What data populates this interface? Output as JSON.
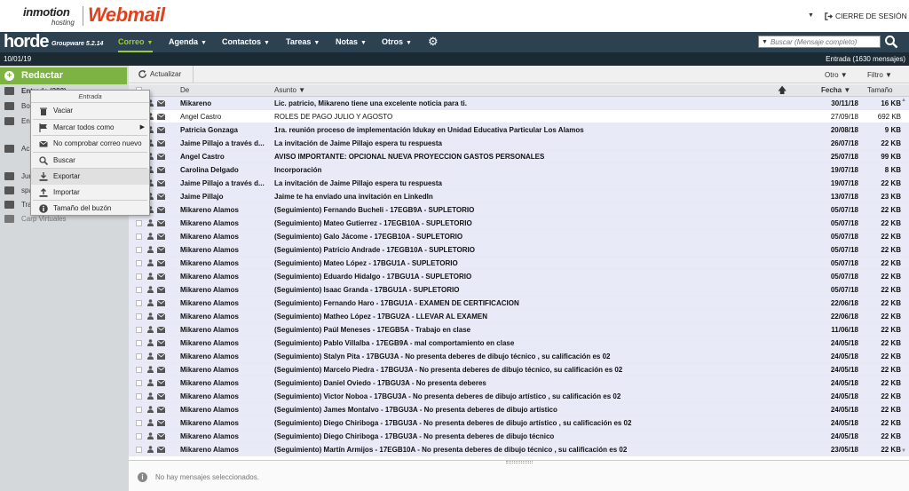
{
  "brand": {
    "inmotion": "inmotion",
    "hosting": "hosting",
    "webmail": "Webmail"
  },
  "header": {
    "logout_label": "CIERRE DE SESIÓN"
  },
  "topnav": {
    "logo": "horde",
    "version": "Groupware 5.2.14",
    "items": [
      {
        "label": "Correo",
        "active": true
      },
      {
        "label": "Agenda",
        "active": false
      },
      {
        "label": "Contactos",
        "active": false
      },
      {
        "label": "Tareas",
        "active": false
      },
      {
        "label": "Notas",
        "active": false
      },
      {
        "label": "Otros",
        "active": false
      }
    ],
    "search_placeholder": "Buscar (Mensaje completo)"
  },
  "statusbar": {
    "date": "10/01/19",
    "mailbox_info": "Entrada (1630 mensajes)"
  },
  "sidebar": {
    "compose_label": "Redactar",
    "folders": [
      {
        "label": "Entrada (282)",
        "icon": "inbox-icon"
      },
      {
        "label": "Bo",
        "icon": "drafts-icon"
      },
      {
        "label": "En",
        "icon": "sent-icon"
      },
      {
        "label": "Ac",
        "icon": "folder-icon"
      },
      {
        "label": "Jur",
        "icon": "folder-icon"
      },
      {
        "label": "spa",
        "icon": "folder-icon"
      },
      {
        "label": "Tra",
        "icon": "trash-icon"
      },
      {
        "label": "Carp Virtuales",
        "icon": "virtual-folder-icon"
      }
    ]
  },
  "context_menu": {
    "title": "Entrada",
    "items": [
      {
        "label": "Vaciar",
        "icon": "trash-icon"
      },
      {
        "label": "Marcar todos como",
        "icon": "flag-icon",
        "submenu": true
      },
      {
        "label": "No comprobar correo nuevo",
        "icon": "envelope-icon"
      },
      {
        "label": "Buscar",
        "icon": "search-icon"
      },
      {
        "label": "Exportar",
        "icon": "download-icon",
        "highlighted": true
      },
      {
        "label": "Importar",
        "icon": "upload-icon"
      },
      {
        "label": "Tamaño del buzón",
        "icon": "info-icon"
      }
    ]
  },
  "toolbar": {
    "refresh_label": "Actualizar",
    "other_label": "Otro",
    "filter_label": "Filtro"
  },
  "columns": {
    "from": "De",
    "subject": "Asunto",
    "date": "Fecha",
    "size": "Tamaño"
  },
  "messages": [
    {
      "from": "Mikareno",
      "subject": "Lic. patricio, Mikareno tiene una excelente noticia para ti.",
      "date": "30/11/18",
      "size": "16 KB",
      "unseen": true
    },
    {
      "from": "Angel Castro",
      "subject": "ROLES DE PAGO JULIO Y AGOSTO",
      "date": "27/09/18",
      "size": "692 KB",
      "unseen": false
    },
    {
      "from": "Patricia Gonzaga",
      "subject": "1ra. reunión proceso de implementación Idukay en Unidad Educativa Particular Los Alamos",
      "date": "20/08/18",
      "size": "9 KB",
      "unseen": true
    },
    {
      "from": "Jaime Pillajo a través d...",
      "subject": "La invitación de Jaime Pillajo espera tu respuesta",
      "date": "26/07/18",
      "size": "22 KB",
      "unseen": true
    },
    {
      "from": "Angel Castro",
      "subject": "AVISO IMPORTANTE: OPCIONAL NUEVA PROYECCION GASTOS PERSONALES",
      "date": "25/07/18",
      "size": "99 KB",
      "unseen": true
    },
    {
      "from": "Carolina Delgado",
      "subject": "Incorporación",
      "date": "19/07/18",
      "size": "8 KB",
      "unseen": true
    },
    {
      "from": "Jaime Pillajo a través d...",
      "subject": "La invitación de Jaime Pillajo espera tu respuesta",
      "date": "19/07/18",
      "size": "22 KB",
      "unseen": true
    },
    {
      "from": "Jaime Pillajo",
      "subject": "Jaime te ha enviado una invitación en LinkedIn",
      "date": "13/07/18",
      "size": "23 KB",
      "unseen": true
    },
    {
      "from": "Mikareno Alamos",
      "subject": "(Seguimiento) Fernando Bucheli - 17EGB9A - SUPLETORIO",
      "date": "05/07/18",
      "size": "22 KB",
      "unseen": true
    },
    {
      "from": "Mikareno Alamos",
      "subject": "(Seguimiento) Mateo Gutierrez - 17EGB10A - SUPLETORIO",
      "date": "05/07/18",
      "size": "22 KB",
      "unseen": true
    },
    {
      "from": "Mikareno Alamos",
      "subject": "(Seguimiento) Galo Jácome - 17EGB10A - SUPLETORIO",
      "date": "05/07/18",
      "size": "22 KB",
      "unseen": true
    },
    {
      "from": "Mikareno Alamos",
      "subject": "(Seguimiento) Patricio Andrade - 17EGB10A - SUPLETORIO",
      "date": "05/07/18",
      "size": "22 KB",
      "unseen": true
    },
    {
      "from": "Mikareno Alamos",
      "subject": "(Seguimiento) Mateo López - 17BGU1A - SUPLETORIO",
      "date": "05/07/18",
      "size": "22 KB",
      "unseen": true
    },
    {
      "from": "Mikareno Alamos",
      "subject": "(Seguimiento) Eduardo Hidalgo - 17BGU1A - SUPLETORIO",
      "date": "05/07/18",
      "size": "22 KB",
      "unseen": true
    },
    {
      "from": "Mikareno Alamos",
      "subject": "(Seguimiento) Isaac Granda - 17BGU1A - SUPLETORIO",
      "date": "05/07/18",
      "size": "22 KB",
      "unseen": true
    },
    {
      "from": "Mikareno Alamos",
      "subject": "(Seguimiento) Fernando Haro - 17BGU1A - EXAMEN DE CERTIFICACION",
      "date": "22/06/18",
      "size": "22 KB",
      "unseen": true
    },
    {
      "from": "Mikareno Alamos",
      "subject": "(Seguimiento) Matheo López - 17BGU2A - LLEVAR AL EXAMEN",
      "date": "22/06/18",
      "size": "22 KB",
      "unseen": true
    },
    {
      "from": "Mikareno Alamos",
      "subject": "(Seguimiento) Paúl Meneses - 17EGB5A - Trabajo en clase",
      "date": "11/06/18",
      "size": "22 KB",
      "unseen": true
    },
    {
      "from": "Mikareno Alamos",
      "subject": "(Seguimiento) Pablo Villalba - 17EGB9A - mal comportamiento en clase",
      "date": "24/05/18",
      "size": "22 KB",
      "unseen": true
    },
    {
      "from": "Mikareno Alamos",
      "subject": "(Seguimiento) Stalyn Pita - 17BGU3A - No presenta deberes de dibujo técnico , su calificación es 02",
      "date": "24/05/18",
      "size": "22 KB",
      "unseen": true
    },
    {
      "from": "Mikareno Alamos",
      "subject": "(Seguimiento) Marcelo Piedra - 17BGU3A - No presenta deberes de dibujo técnico, su calificación es 02",
      "date": "24/05/18",
      "size": "22 KB",
      "unseen": true
    },
    {
      "from": "Mikareno Alamos",
      "subject": "(Seguimiento) Daniel Oviedo - 17BGU3A - No presenta deberes",
      "date": "24/05/18",
      "size": "22 KB",
      "unseen": true
    },
    {
      "from": "Mikareno Alamos",
      "subject": "(Seguimiento) Victor Noboa - 17BGU3A - No presenta deberes de dibujo artístico , su calificación es 02",
      "date": "24/05/18",
      "size": "22 KB",
      "unseen": true
    },
    {
      "from": "Mikareno Alamos",
      "subject": "(Seguimiento) James Montalvo - 17BGU3A - No presenta deberes de dibujo artístico",
      "date": "24/05/18",
      "size": "22 KB",
      "unseen": true
    },
    {
      "from": "Mikareno Alamos",
      "subject": "(Seguimiento) Diego Chiriboga - 17BGU3A - No presenta deberes de dibujo artístico , su calificación es 02",
      "date": "24/05/18",
      "size": "22 KB",
      "unseen": true
    },
    {
      "from": "Mikareno Alamos",
      "subject": "(Seguimiento) Diego Chiriboga - 17BGU3A - No presenta deberes de dibujo técnico",
      "date": "24/05/18",
      "size": "22 KB",
      "unseen": true
    },
    {
      "from": "Mikareno Alamos",
      "subject": "(Seguimiento) Martín Armijos - 17EGB10A - No presenta deberes de dibujo técnico , su calificación es 02",
      "date": "23/05/18",
      "size": "22 KB",
      "unseen": true
    }
  ],
  "preview": {
    "empty_text": "No hay mensajes seleccionados."
  }
}
